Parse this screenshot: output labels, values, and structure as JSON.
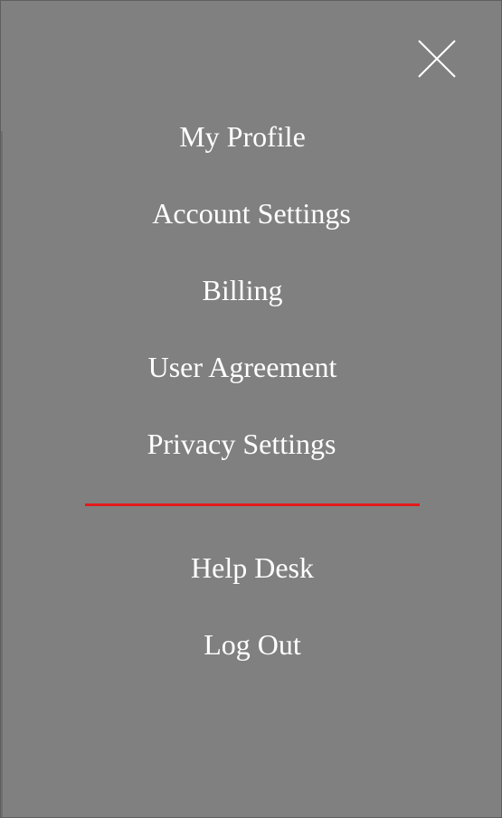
{
  "menu": {
    "close_icon": "close-icon",
    "items": [
      {
        "label": "My Profile"
      },
      {
        "label": "Account Settings"
      },
      {
        "label": "Billing"
      },
      {
        "label": "User Agreement"
      },
      {
        "label": "Privacy Settings"
      }
    ],
    "secondary_items": [
      {
        "label": "Help Desk"
      },
      {
        "label": "Log Out"
      }
    ]
  },
  "colors": {
    "panel_background": "#808080",
    "text": "#ffffff",
    "divider": "#e31a1c"
  }
}
